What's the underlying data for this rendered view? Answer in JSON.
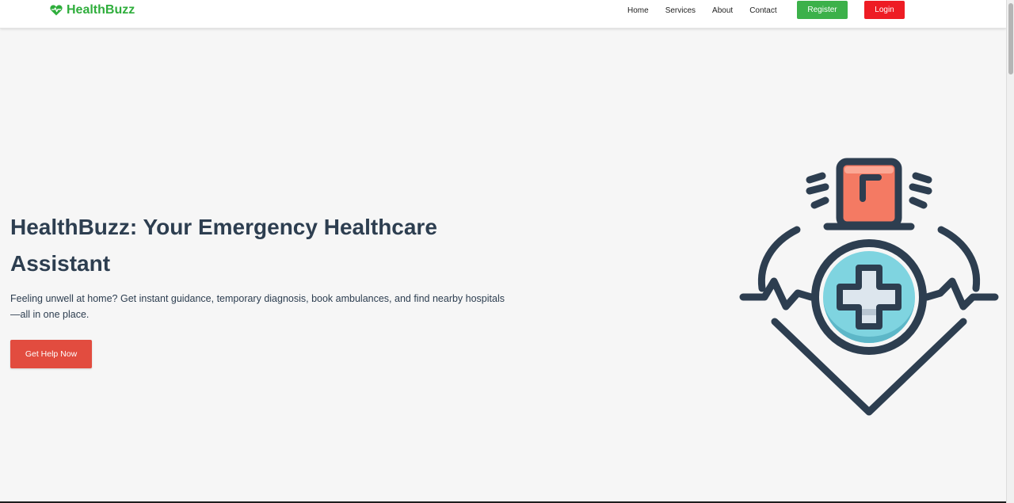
{
  "navbar": {
    "brand_name": "HealthBuzz",
    "brand_icon": "heart-pulse-icon",
    "links": [
      "Home",
      "Services",
      "About",
      "Contact"
    ],
    "register_label": "Register",
    "login_label": "Login"
  },
  "hero": {
    "title": "HealthBuzz: Your Emergency Healthcare Assistant",
    "description": "Feeling unwell at home? Get instant guidance, temporary diagnosis, book ambulances, and find nearby hospitals —all in one place.",
    "cta_label": "Get Help Now",
    "illustration_icon": "emergency-medical-icon"
  },
  "colors": {
    "brand": "#2fae3c",
    "register": "#3cb14a",
    "login": "#ee1c24",
    "cta": "#e24c3f",
    "heading": "#2d3e50",
    "siren": "#f47a63",
    "cross_circle": "#7fd4e0"
  }
}
